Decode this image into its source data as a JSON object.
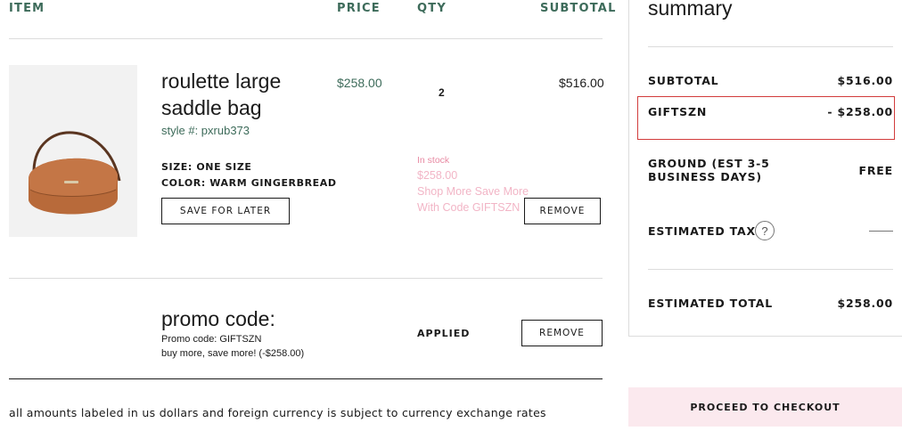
{
  "table": {
    "headers": {
      "item": "ITEM",
      "price": "PRICE",
      "qty": "QTY",
      "subtotal": "SUBTOTAL"
    }
  },
  "product": {
    "name": "roulette large saddle bag",
    "style": "style #: pxrub373",
    "size": "SIZE: ONE SIZE",
    "color": "COLOR: WARM GINGERBREAD",
    "save_label": "SAVE FOR LATER",
    "price": "$258.00",
    "qty": "2",
    "subtotal": "$516.00",
    "stock": "In stock",
    "promo_price": "$258.00",
    "promo_message": "Shop More Save More With Code GIFTSZN",
    "remove_label": "REMOVE"
  },
  "promo": {
    "title": "promo code:",
    "code_line": "Promo code: GIFTSZN",
    "desc_line": "buy more, save more! (-$258.00)",
    "status": "APPLIED",
    "remove_label": "REMOVE"
  },
  "disclaimer": "all amounts labeled in us dollars and foreign currency is subject to currency exchange rates",
  "summary": {
    "title": "summary",
    "subtotal_label": "SUBTOTAL",
    "subtotal_value": "$516.00",
    "discount_label": "GIFTSZN",
    "discount_value": "- $258.00",
    "shipping_label": "GROUND (EST 3-5 BUSINESS DAYS)",
    "shipping_value": "FREE",
    "tax_label": "ESTIMATED TAX",
    "tax_help": "?",
    "total_label": "ESTIMATED TOTAL",
    "total_value": "$258.00",
    "checkout_label": "PROCEED TO CHECKOUT"
  },
  "colors": {
    "accent_green": "#3d6b5a",
    "promo_pink": "#f2b5c6",
    "checkout_bg": "#fbe9ee",
    "highlight_red": "#d23c3c",
    "bag_brown": "#b86a3a"
  }
}
